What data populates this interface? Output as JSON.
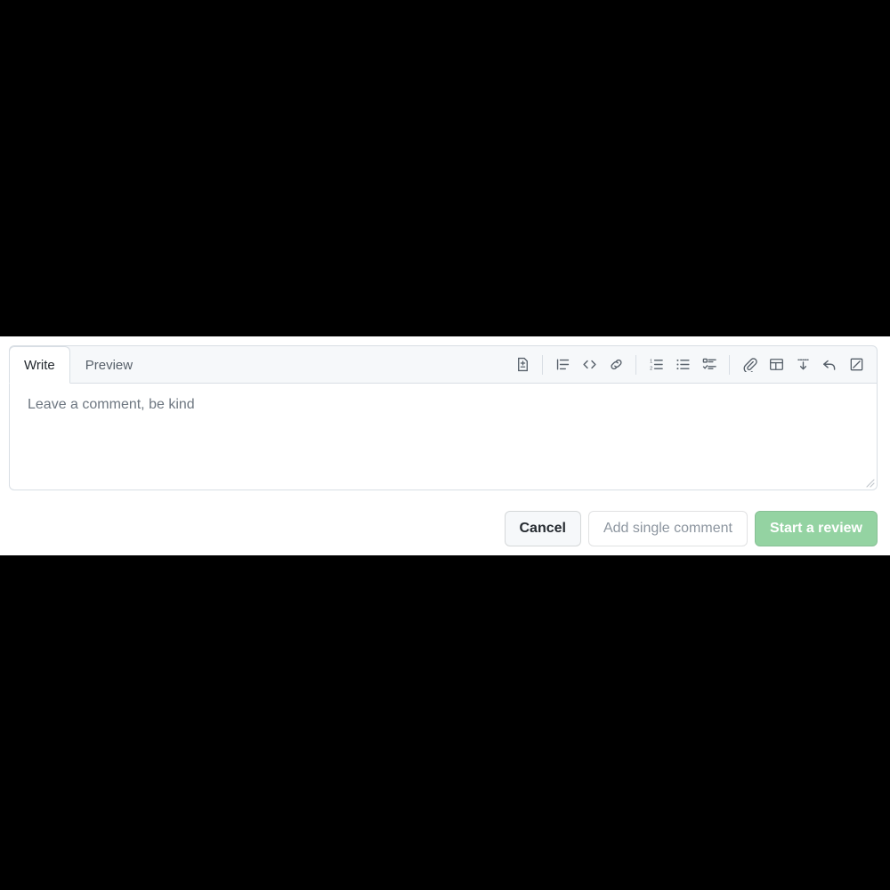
{
  "panel": {
    "background_color": "#ffffff",
    "page_background_color": "#000000"
  },
  "tabs": [
    {
      "id": "write",
      "label": "Write",
      "active": true
    },
    {
      "id": "preview",
      "label": "Preview",
      "active": false
    }
  ],
  "toolbar": {
    "items": [
      {
        "id": "suggest-changes",
        "icon": "suggest-changes-icon",
        "title": "Add a suggestion"
      },
      {
        "id": "sep-1",
        "icon": "separator"
      },
      {
        "id": "heading",
        "icon": "heading-icon",
        "title": "Add heading text"
      },
      {
        "id": "code",
        "icon": "code-icon",
        "title": "Insert code"
      },
      {
        "id": "link",
        "icon": "link-icon",
        "title": "Add a link"
      },
      {
        "id": "sep-2",
        "icon": "separator"
      },
      {
        "id": "ordered-list",
        "icon": "ordered-list-icon",
        "title": "Add a numbered list"
      },
      {
        "id": "unordered-list",
        "icon": "unordered-list-icon",
        "title": "Add a bulleted list"
      },
      {
        "id": "task-list",
        "icon": "task-list-icon",
        "title": "Add a task list"
      },
      {
        "id": "sep-3",
        "icon": "separator"
      },
      {
        "id": "attach-files",
        "icon": "paperclip-icon",
        "title": "Attach files"
      },
      {
        "id": "table",
        "icon": "table-icon",
        "title": "Add a table"
      },
      {
        "id": "saved-replies",
        "icon": "saved-reply-icon",
        "title": "Insert a reply"
      },
      {
        "id": "reference",
        "icon": "reply-arrow-icon",
        "title": "Reference in new issue"
      },
      {
        "id": "fullscreen",
        "icon": "fullscreen-icon",
        "title": "Toggle fullscreen"
      }
    ]
  },
  "comment_box": {
    "value": "",
    "placeholder": "Leave a comment, be kind"
  },
  "buttons": {
    "cancel": {
      "label": "Cancel",
      "style": "default",
      "disabled": false
    },
    "add_single_comment": {
      "label": "Add single comment",
      "style": "muted",
      "disabled": true
    },
    "start_review": {
      "label": "Start a review",
      "style": "primary",
      "disabled": true,
      "color": "#94d3a2"
    }
  }
}
